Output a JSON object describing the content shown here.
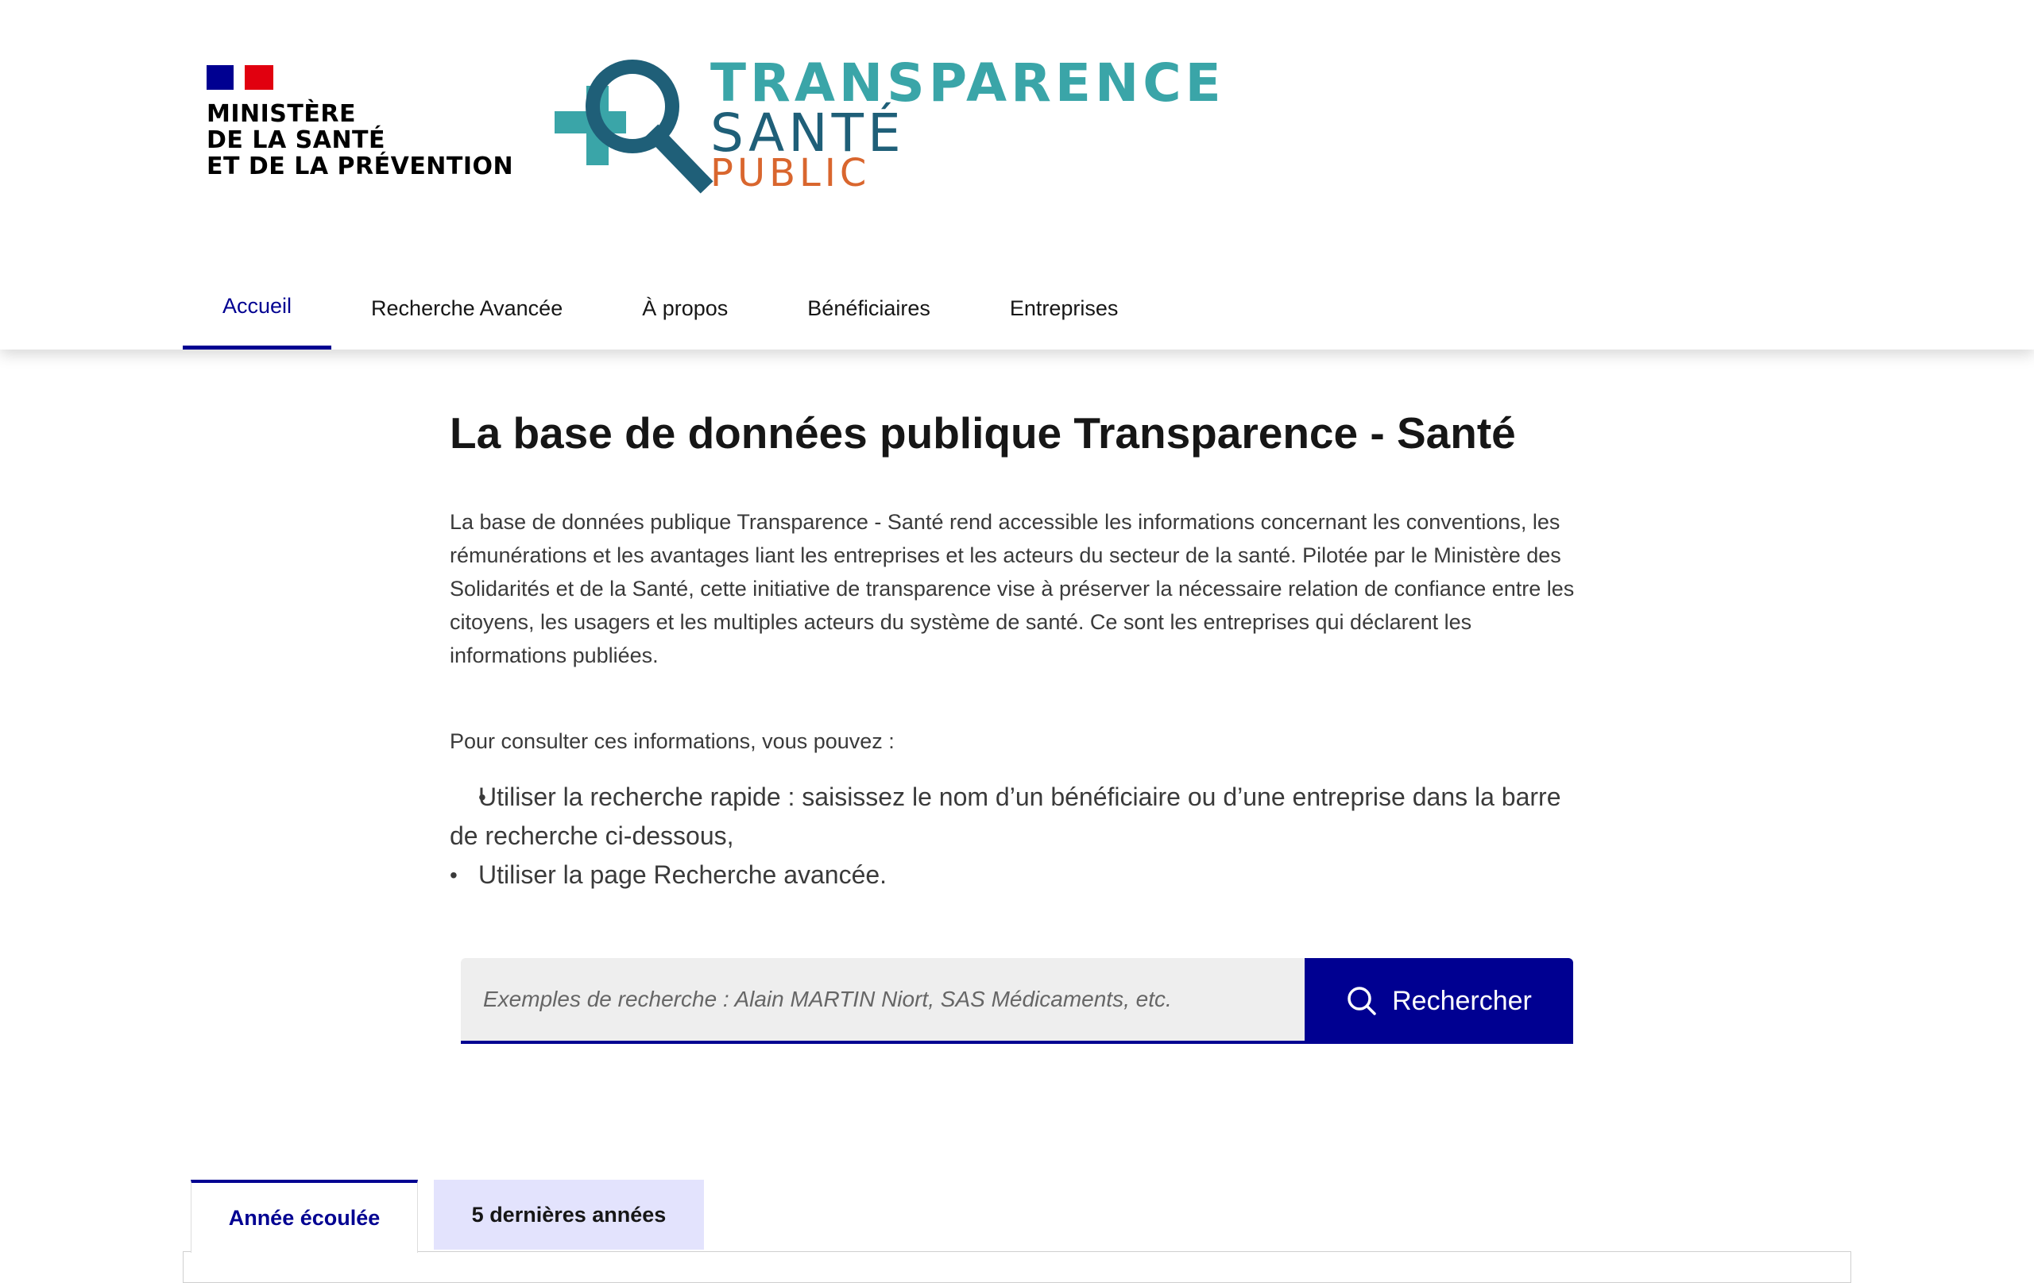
{
  "header": {
    "ministry_name": "MINISTÈRE\nDE LA SANTÉ\nET DE LA PRÉVENTION",
    "logo": {
      "line1": "TRANSPARENCE",
      "line2": "SANTÉ",
      "line3": "PUBLIC"
    }
  },
  "nav": {
    "items": [
      {
        "label": "Accueil",
        "active": true
      },
      {
        "label": "Recherche Avancée",
        "active": false
      },
      {
        "label": "À propos",
        "active": false
      },
      {
        "label": "Bénéficiaires",
        "active": false
      },
      {
        "label": "Entreprises",
        "active": false
      }
    ]
  },
  "main": {
    "title": "La base de données publique Transparence - Santé",
    "intro": "La base de données publique Transparence - Santé rend accessible les informations concernant les conventions, les rémunérations et les avantages liant les entreprises et les acteurs du secteur de la santé. Pilotée par le Ministère des Solidarités et de la Santé, cette initiative de transparence vise à préserver la nécessaire relation de confiance entre les citoyens, les usagers et les multiples acteurs du système de santé. Ce sont les entreprises qui déclarent les informations publiées.",
    "consult_lead": "Pour consulter ces informations, vous pouvez :",
    "options": [
      "Utiliser la recherche rapide : saisissez le nom d’un bénéficiaire ou d’une entreprise dans la barre de recherche ci-dessous,",
      "Utiliser la page Recherche avancée."
    ]
  },
  "search": {
    "placeholder": "Exemples de recherche : Alain MARTIN Niort, SAS Médicaments, etc.",
    "value": "",
    "button_label": "Rechercher"
  },
  "tabs": [
    {
      "label": "Année écoulée",
      "active": true
    },
    {
      "label": "5 dernières années",
      "active": false
    }
  ],
  "colors": {
    "primary": "#000091",
    "teal": "#3aa5a8",
    "dark_teal": "#1f5f78",
    "orange": "#d9662e",
    "tab_inactive_bg": "#e3e3fd",
    "input_bg": "#eeeeee"
  }
}
